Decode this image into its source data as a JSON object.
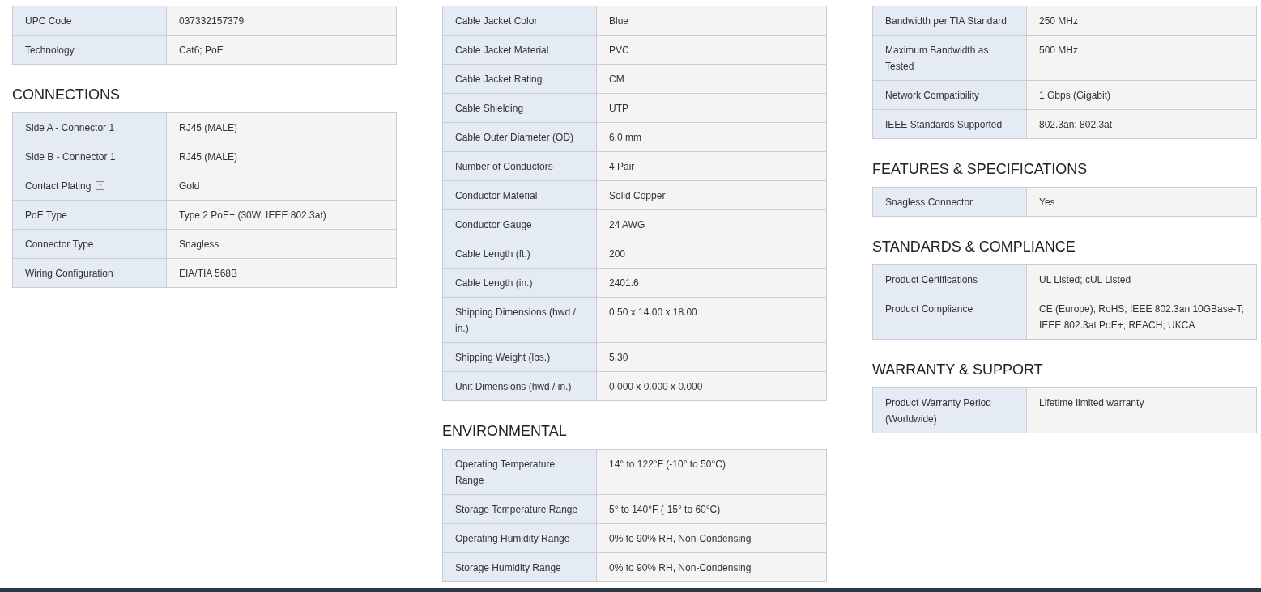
{
  "columns": [
    {
      "sections": [
        {
          "rows": [
            {
              "label": "UPC Code",
              "value": "037332157379"
            },
            {
              "label": "Technology",
              "value": "Cat6; PoE"
            }
          ]
        },
        {
          "heading": "CONNECTIONS",
          "rows": [
            {
              "label": "Side A - Connector 1",
              "value": "RJ45 (MALE)"
            },
            {
              "label": "Side B - Connector 1",
              "value": "RJ45 (MALE)"
            },
            {
              "label": "Contact Plating",
              "value": "Gold",
              "help": true
            },
            {
              "label": "PoE Type",
              "value": "Type 2 PoE+ (30W, IEEE 802.3at)"
            },
            {
              "label": "Connector Type",
              "value": "Snagless"
            },
            {
              "label": "Wiring Configuration",
              "value": "EIA/TIA 568B"
            }
          ]
        }
      ]
    },
    {
      "sections": [
        {
          "rows": [
            {
              "label": "Cable Jacket Color",
              "value": "Blue"
            },
            {
              "label": "Cable Jacket Material",
              "value": "PVC"
            },
            {
              "label": "Cable Jacket Rating",
              "value": "CM"
            },
            {
              "label": "Cable Shielding",
              "value": "UTP"
            },
            {
              "label": "Cable Outer Diameter (OD)",
              "value": "6.0 mm"
            },
            {
              "label": "Number of Conductors",
              "value": "4 Pair"
            },
            {
              "label": "Conductor Material",
              "value": "Solid Copper"
            },
            {
              "label": "Conductor Gauge",
              "value": "24 AWG"
            },
            {
              "label": "Cable Length (ft.)",
              "value": "200"
            },
            {
              "label": "Cable Length (in.)",
              "value": "2401.6"
            },
            {
              "label": "Shipping Dimensions (hwd / in.)",
              "value": "0.50 x 14.00 x 18.00"
            },
            {
              "label": "Shipping Weight (lbs.)",
              "value": "5.30"
            },
            {
              "label": "Unit Dimensions (hwd / in.)",
              "value": "0.000 x 0.000 x 0.000"
            }
          ]
        },
        {
          "heading": "ENVIRONMENTAL",
          "rows": [
            {
              "label": "Operating Temperature Range",
              "value": "14° to 122°F (-10° to 50°C)"
            },
            {
              "label": "Storage Temperature Range",
              "value": "5° to 140°F (-15° to 60°C)"
            },
            {
              "label": "Operating Humidity Range",
              "value": "0% to 90% RH, Non-Condensing"
            },
            {
              "label": "Storage Humidity Range",
              "value": "0% to 90% RH, Non-Condensing"
            }
          ]
        }
      ]
    },
    {
      "sections": [
        {
          "rows": [
            {
              "label": "Bandwidth per TIA Standard",
              "value": "250 MHz"
            },
            {
              "label": "Maximum Bandwidth as Tested",
              "value": "500 MHz"
            },
            {
              "label": "Network Compatibility",
              "value": "1 Gbps (Gigabit)"
            },
            {
              "label": "IEEE Standards Supported",
              "value": "802.3an; 802.3at"
            }
          ]
        },
        {
          "heading": "FEATURES & SPECIFICATIONS",
          "rows": [
            {
              "label": "Snagless Connector",
              "value": "Yes"
            }
          ]
        },
        {
          "heading": "STANDARDS & COMPLIANCE",
          "rows": [
            {
              "label": "Product Certifications",
              "value": "UL Listed; cUL Listed"
            },
            {
              "label": "Product Compliance",
              "value": "CE (Europe); RoHS; IEEE 802.3an 10GBase-T; IEEE 802.3at PoE+; REACH; UKCA"
            }
          ]
        },
        {
          "heading": "WARRANTY & SUPPORT",
          "rows": [
            {
              "label": "Product Warranty Period (Worldwide)",
              "value": "Lifetime limited warranty"
            }
          ]
        }
      ]
    }
  ]
}
